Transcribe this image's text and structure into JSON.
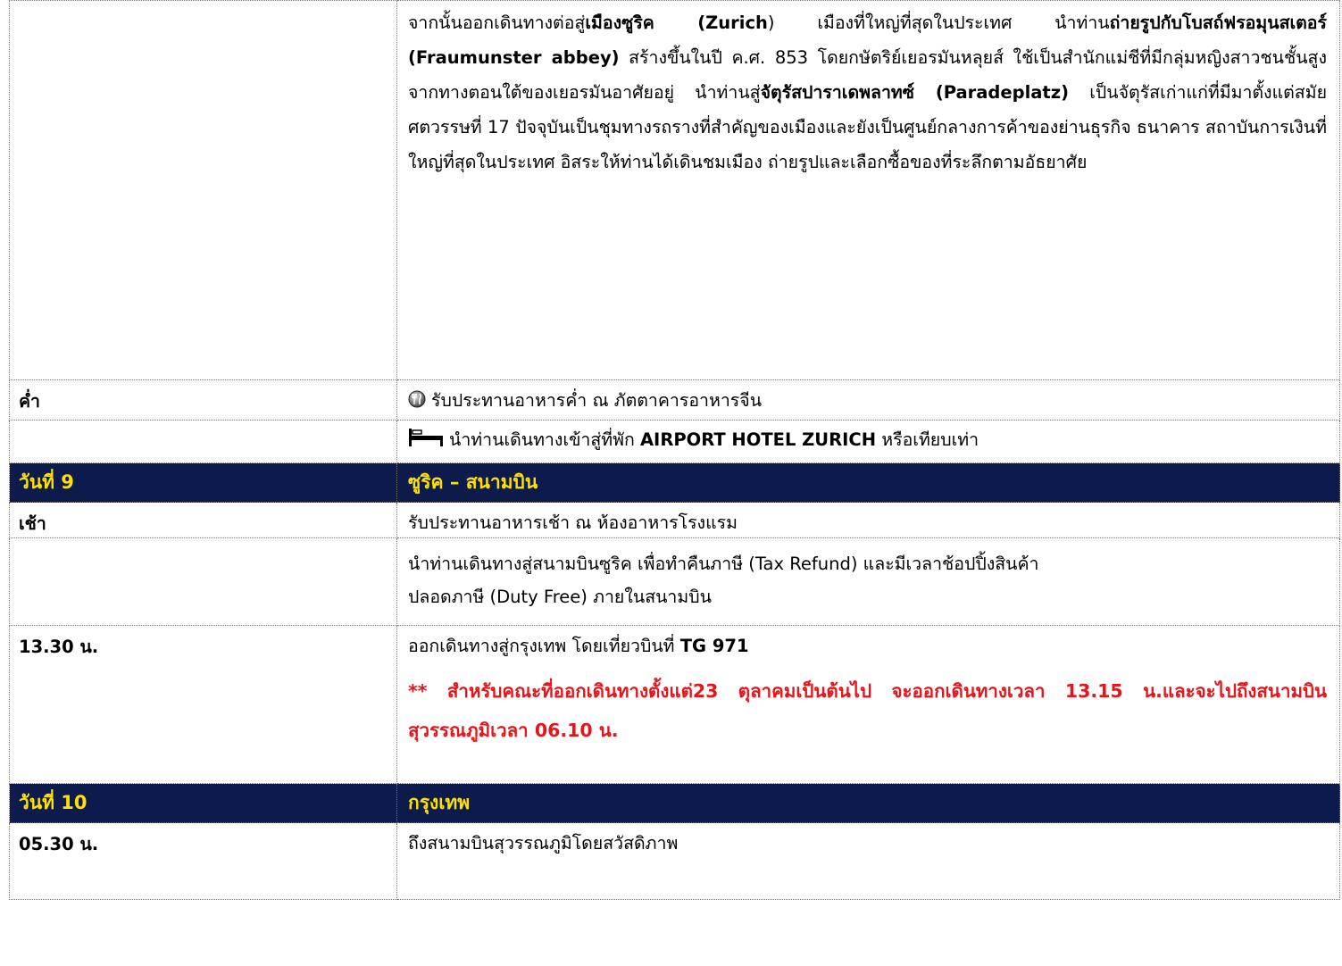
{
  "intro_paragraph": {
    "p1": "จากนั้นออกเดินทางต่อสู่",
    "b1": "เมืองซูริค (Zurich",
    "p2": ")   เมืองที่ใหญ่ที่สุดในประเทศ นำท่าน",
    "b2": "ถ่ายรูปกับโบสถ์ฟรอมุนสเตอร์ (Fraumunster  abbey)",
    "p3": "  สร้างขึ้นในปี ค.ศ. 853 โดยกษัตริย์เยอรมันหลุยส์ ใช้เป็นสำนักแม่ชีที่มีกลุ่มหญิงสาวชนชั้นสูงจากทางตอนใต้ของเยอรมันอาศัยอยู่ นำท่านสู่",
    "b3": "จัตุรัสปาราเดพลาทซ์ (Paradeplatz)",
    "p4": "  เป็นจัตุรัสเก่าแก่ที่มีมาตั้งแต่สมัยศตวรรษที่ 17 ปัจจุบันเป็นชุมทางรถรางที่สำคัญของเมืองและยังเป็นศูนย์กลางการค้าของย่านธุรกิจ ธนาคาร สถาบันการเงินที่ใหญ่ที่สุดในประเทศ อิสระให้ท่านได้เดินชมเมือง ถ่ายรูปและเลือกซื้อของที่ระลึกตามอัธยาศัย"
  },
  "dinner": {
    "time": "ค่ำ",
    "text": "รับประทานอาหารค่ำ ณ ภัตตาคารอาหารจีน",
    "icon": "dining-icon"
  },
  "hotel": {
    "text_before": "นำท่านเดินทางเข้าสู่ที่พัก ",
    "hotel_name": "AIRPORT HOTEL ZURICH",
    "text_after": " หรือเทียบเท่า",
    "icon": "bed-icon"
  },
  "day9": {
    "label": "วันที่ 9",
    "title": "ซูริค – สนามบิน"
  },
  "breakfast": {
    "time": "เช้า",
    "text": "รับประทานอาหารเช้า ณ ห้องอาหารโรงแรม"
  },
  "airport": {
    "line1": "นำท่านเดินทางสู่สนามบินซูริค เพื่อทำคืนภาษี (Tax Refund) และมีเวลาช้อปปิ้งสินค้า",
    "line2": "ปลอดภาษี (Duty Free) ภายในสนามบิน"
  },
  "departure": {
    "time": "13.30 น.",
    "text_before": "ออกเดินทางสู่กรุงเทพ โดยเที่ยวบินที่ ",
    "flight": "TG 971",
    "note": "**  สำหรับคณะที่ออกเดินทางตั้งแต่23 ตุลาคมเป็นต้นไป จะออกเดินทางเวลา 13.15 น.และจะไปถึงสนามบินสุวรรณภูมิเวลา 06.10 น."
  },
  "day10": {
    "label": "วันที่ 10",
    "title": "กรุงเทพ"
  },
  "arrival": {
    "time": "05.30 น.",
    "text": "ถึงสนามบินสุวรรณภูมิโดยสวัสดิภาพ"
  },
  "colors": {
    "day_header_bg": "#0d1b4c",
    "day_header_text": "#ffe100",
    "note_red": "#e8141a"
  }
}
